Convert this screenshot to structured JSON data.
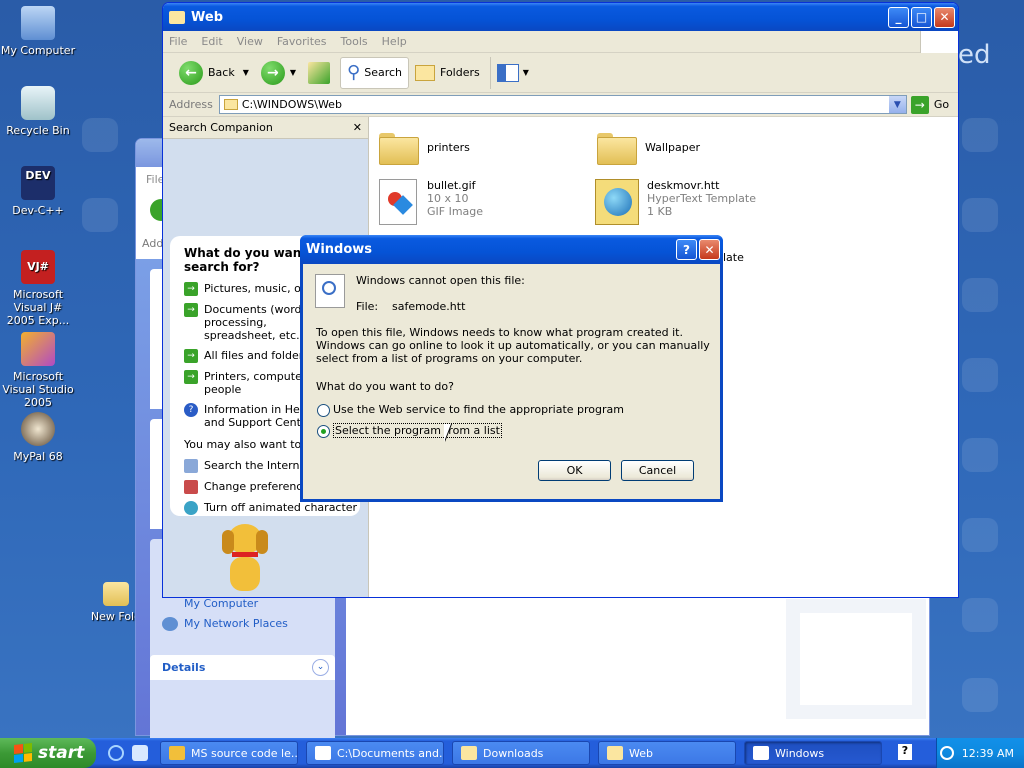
{
  "desktop": {
    "icons": [
      {
        "label": "My Computer",
        "icon": "my-computer-icon"
      },
      {
        "label": "Recycle Bin",
        "icon": "recycle-bin-icon"
      },
      {
        "label": "Dev-C++",
        "icon": "devcpp-icon"
      },
      {
        "label": "Microsoft Visual J# 2005 Exp...",
        "icon": "vj-icon"
      },
      {
        "label": "Microsoft Visual Studio 2005",
        "icon": "vs-icon"
      },
      {
        "label": "MyPal 68",
        "icon": "mypal-icon"
      },
      {
        "label": "New Fold",
        "icon": "folder-icon"
      }
    ],
    "wallpaper_text": "ed"
  },
  "back_window": {
    "menu_file": "File",
    "address_label": "Addr",
    "places": {
      "my_computer": "My Computer",
      "my_network": "My Network Places"
    },
    "details_title": "Details"
  },
  "main_window": {
    "title": "Web",
    "menu": [
      "File",
      "Edit",
      "View",
      "Favorites",
      "Tools",
      "Help"
    ],
    "toolbar": {
      "back": "Back",
      "search": "Search",
      "folders": "Folders"
    },
    "address": {
      "label": "Address",
      "value": "C:\\WINDOWS\\Web",
      "go": "Go"
    },
    "search_companion": {
      "header": "Search Companion",
      "close": "✕",
      "question": "What do you want to search for?",
      "options": [
        "Pictures, music, or video",
        "Documents (word processing, spreadsheet, etc.)",
        "All files and folders",
        "Printers, computers, or people",
        "Information in Help and Support Center"
      ],
      "also_label": "You may also want to...",
      "also": [
        "Search the Internet",
        "Change preferences",
        "Turn off animated character"
      ]
    },
    "files": [
      {
        "name": "printers",
        "type": "folder"
      },
      {
        "name": "Wallpaper",
        "type": "folder"
      },
      {
        "name": "bullet.gif",
        "line2": "10 x 10",
        "line3": "GIF Image"
      },
      {
        "name": "deskmovr.htt",
        "line2": "HyperText Template",
        "line3": "1 KB"
      },
      {
        "name": "late"
      }
    ]
  },
  "dialog": {
    "title": "Windows",
    "message": "Windows cannot open this file:",
    "file_label": "File:",
    "file_name": "safemode.htt",
    "explanation": "To open this file, Windows needs to know what program created it.  Windows can go online to look it up automatically, or you can manually select from a list of programs on your computer.",
    "question": "What do you want to do?",
    "option_web": "Use the Web service to find the appropriate program",
    "option_list": "Select the program from a list",
    "selected": "option_list",
    "ok": "OK",
    "cancel": "Cancel"
  },
  "taskbar": {
    "start": "start",
    "tasks": [
      {
        "label": "MS source code le...",
        "active": false
      },
      {
        "label": "C:\\Documents and...",
        "active": false
      },
      {
        "label": "Downloads",
        "active": false
      },
      {
        "label": "Web",
        "active": false
      },
      {
        "label": "Windows",
        "active": true
      }
    ],
    "clock": "12:39 AM"
  },
  "colors": {
    "xp_blue": "#0a5ae0",
    "taskbar": "#245edb",
    "start_green": "#3c9a36",
    "link_blue": "#215dc6"
  }
}
